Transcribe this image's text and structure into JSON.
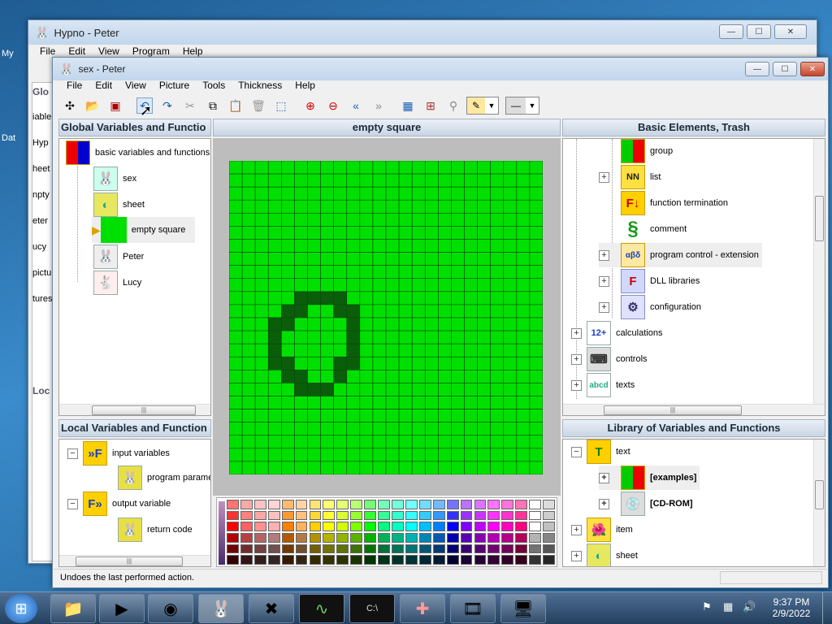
{
  "desktop": {
    "labels": [
      "My",
      "Dat"
    ]
  },
  "outer_window": {
    "title": "Hypno - Peter",
    "menu": [
      "File",
      "Edit",
      "View",
      "Program",
      "Help"
    ],
    "side_fragments": [
      "Glo",
      "iable",
      "Hyp",
      "heet",
      "npty",
      "eter",
      "ucy",
      "pictu",
      "tures",
      "Loc"
    ]
  },
  "window": {
    "title": "sex - Peter",
    "menu": [
      "File",
      "Edit",
      "View",
      "Picture",
      "Tools",
      "Thickness",
      "Help"
    ],
    "controls": {
      "minimize": "—",
      "maximize": "☐",
      "close": "✕"
    }
  },
  "global_panel": {
    "title": "Global Variables and Functio",
    "items": [
      {
        "label": "basic variables and functions",
        "icon": "grid-icon"
      },
      {
        "label": "sex",
        "icon": "bunny-icon"
      },
      {
        "label": "sheet",
        "icon": "sheet-icon"
      },
      {
        "label": "empty square",
        "icon": "green-square-icon"
      },
      {
        "label": "Peter",
        "icon": "bunny-icon"
      },
      {
        "label": "Lucy",
        "icon": "bunny-girl-icon"
      }
    ]
  },
  "local_panel": {
    "title": "Local Variables and Function",
    "items": [
      {
        "label": "input variables",
        "expander": "−"
      },
      {
        "label": "program parame"
      },
      {
        "label": "output variable",
        "expander": "−"
      },
      {
        "label": "return code"
      }
    ]
  },
  "canvas": {
    "title": "empty square",
    "grid_cols": 24,
    "grid_rows": 24,
    "fill_color": "#00e000",
    "outline_color": "#0a5e0a"
  },
  "palette": {
    "colors": [
      "#ff0000",
      "#ff6060",
      "#ff9090",
      "#ffb0b0",
      "#ff8000",
      "#ffb060",
      "#ffd000",
      "#ffff00",
      "#d0ff00",
      "#80ff00",
      "#00ff00",
      "#00ff80",
      "#00ffc0",
      "#00ffff",
      "#00c0ff",
      "#0080ff",
      "#0000ff",
      "#8000ff",
      "#c000ff",
      "#ff00ff",
      "#ff00c0",
      "#ff0080",
      "#ffffff",
      "#c0c0c0"
    ]
  },
  "elements_panel": {
    "title": "Basic Elements, Trash",
    "items": [
      {
        "label": "group",
        "expander": ""
      },
      {
        "label": "list",
        "expander": "+"
      },
      {
        "label": "function termination",
        "expander": ""
      },
      {
        "label": "comment",
        "expander": ""
      },
      {
        "label": "program control - extension",
        "expander": "+"
      },
      {
        "label": "DLL libraries",
        "expander": "+"
      },
      {
        "label": "configuration",
        "expander": "+"
      },
      {
        "label": "calculations",
        "expander": "+"
      },
      {
        "label": "controls",
        "expander": "+"
      },
      {
        "label": "texts",
        "expander": "+"
      }
    ]
  },
  "library_panel": {
    "title": "Library of Variables and Functions",
    "items": [
      {
        "label": "text",
        "expander": "−"
      },
      {
        "label": "[examples]",
        "expander": "+"
      },
      {
        "label": "[CD-ROM]",
        "expander": "+"
      },
      {
        "label": "item",
        "expander": "+"
      },
      {
        "label": "sheet",
        "expander": "+"
      }
    ]
  },
  "status": {
    "text": "Undoes the last performed action."
  },
  "taskbar": {
    "time": "9:37 PM",
    "date": "2/9/2022"
  }
}
